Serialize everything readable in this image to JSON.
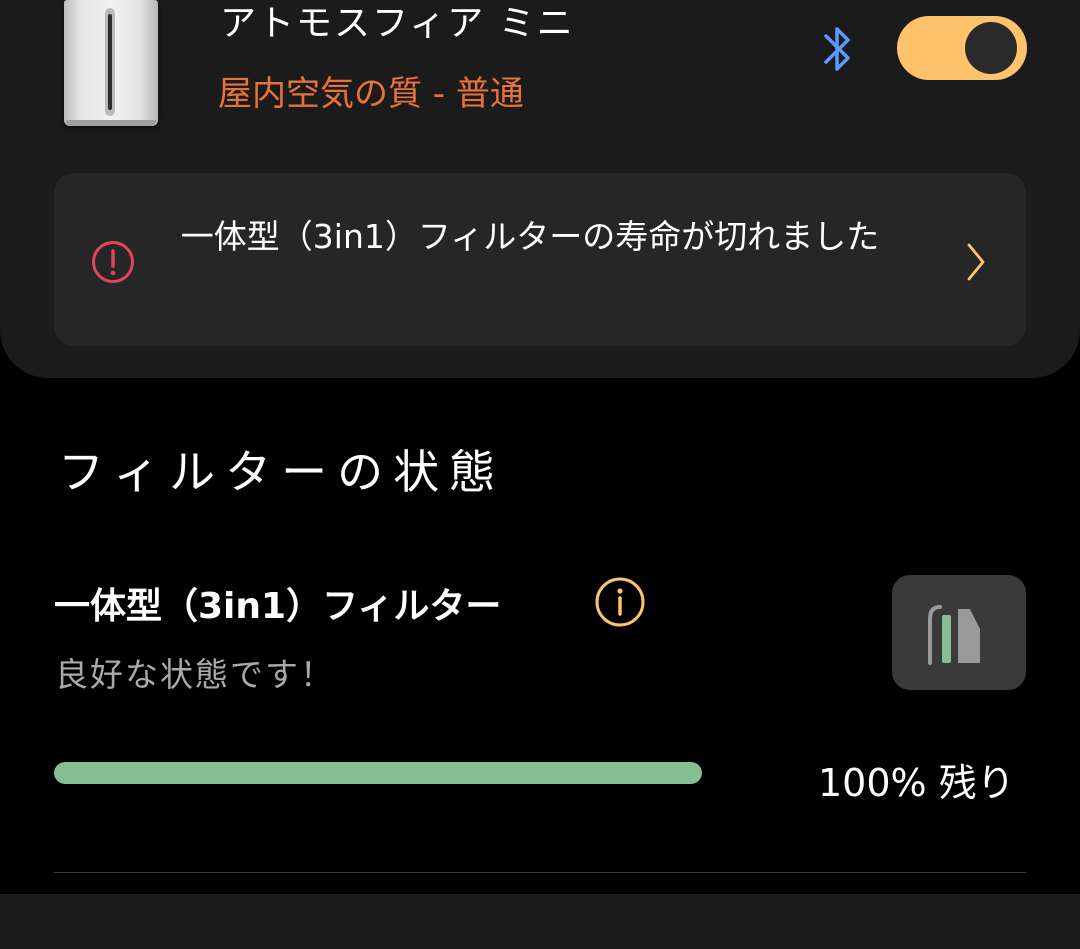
{
  "device": {
    "name": "アトモスフィア ミニ",
    "air_quality": "屋内空気の質 - 普通",
    "power_on": true,
    "colors": {
      "toggle": "#ffc46b",
      "air_quality": "#e8733a",
      "bluetooth": "#5b9bff"
    }
  },
  "alert": {
    "text": "一体型（3in1）フィルターの寿命が切れました",
    "icon": "exclamation-circle-icon"
  },
  "filter_section": {
    "title": "フィルターの状態",
    "filter": {
      "name": "一体型（3in1）フィルター",
      "status": "良好な状態です！",
      "remaining_percent": 100,
      "remaining_label": "100% 残り",
      "bar_color": "#86bf94"
    }
  }
}
